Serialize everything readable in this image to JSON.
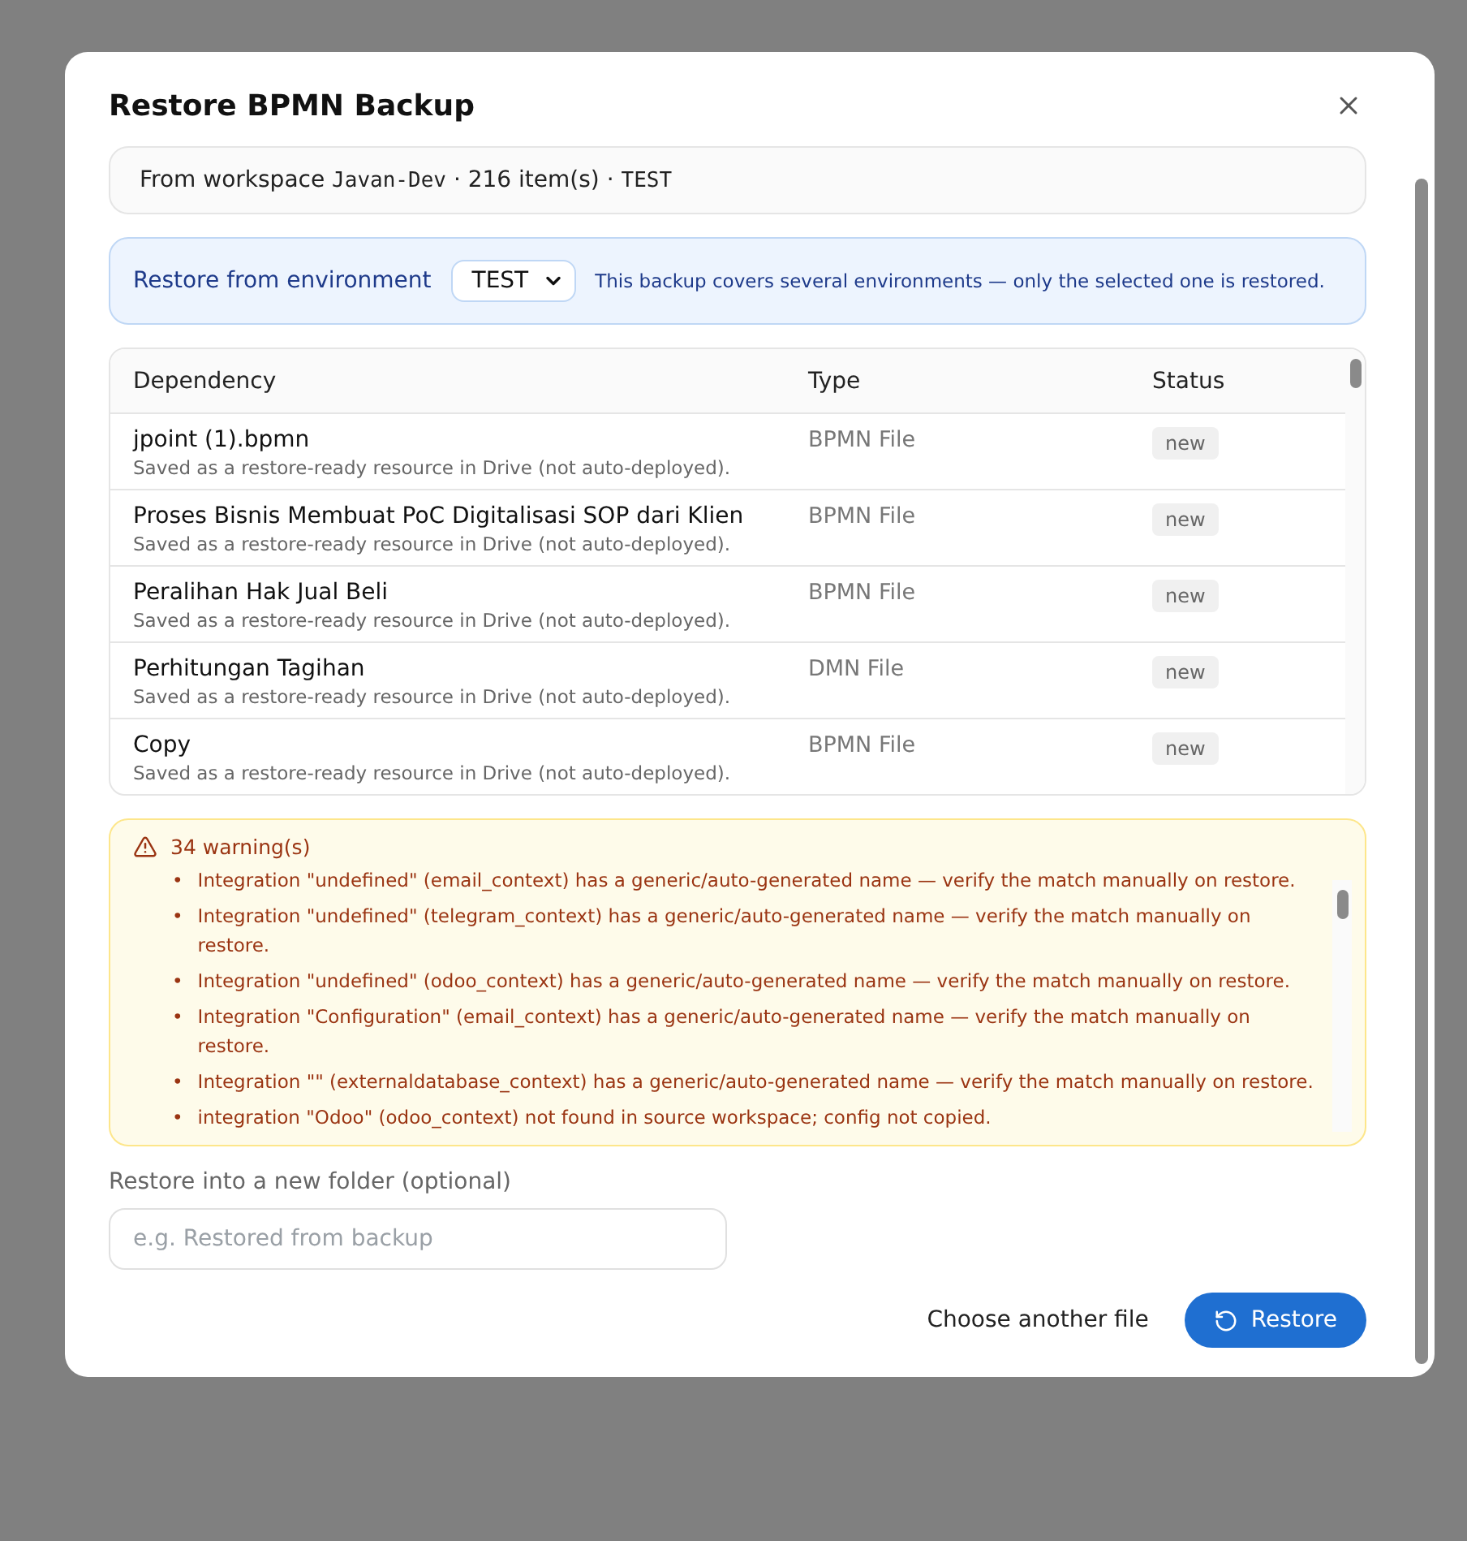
{
  "dialog": {
    "title": "Restore BPMN Backup"
  },
  "source": {
    "separator": "·",
    "prefix": "From workspace",
    "workspace": "Javan-Dev",
    "count": "216 item(s)",
    "environment": "TEST"
  },
  "environment": {
    "label": "Restore from environment",
    "value": "TEST",
    "note": "This backup covers several environments — only the selected one is restored."
  },
  "table": {
    "columns": [
      "Dependency",
      "Type",
      "Status"
    ],
    "rows": [
      {
        "name": "jpoint (1).bpmn",
        "note": "Saved as a restore-ready resource in Drive (not auto-deployed).",
        "type": "BPMN File",
        "status": "new"
      },
      {
        "name": "Proses Bisnis Membuat PoC Digitalisasi SOP dari Klien",
        "note": "Saved as a restore-ready resource in Drive (not auto-deployed).",
        "type": "BPMN File",
        "status": "new"
      },
      {
        "name": "Peralihan Hak Jual Beli",
        "note": "Saved as a restore-ready resource in Drive (not auto-deployed).",
        "type": "BPMN File",
        "status": "new"
      },
      {
        "name": "Perhitungan Tagihan",
        "note": "Saved as a restore-ready resource in Drive (not auto-deployed).",
        "type": "DMN File",
        "status": "new"
      },
      {
        "name": "Copy",
        "note": "Saved as a restore-ready resource in Drive (not auto-deployed).",
        "type": "BPMN File",
        "status": "new"
      }
    ]
  },
  "warnings": {
    "title": "34 warning(s)",
    "bullet": "•",
    "items": [
      "Integration \"undefined\" (email_context) has a generic/auto-generated name — verify the match manually on restore.",
      "Integration \"undefined\" (telegram_context) has a generic/auto-generated name — verify the match manually on restore.",
      "Integration \"undefined\" (odoo_context) has a generic/auto-generated name — verify the match manually on restore.",
      "Integration \"Configuration\" (email_context) has a generic/auto-generated name — verify the match manually on restore.",
      "Integration \"\" (externaldatabase_context) has a generic/auto-generated name — verify the match manually on restore.",
      "integration \"Odoo\" (odoo_context) not found in source workspace; config not copied."
    ]
  },
  "folder": {
    "label": "Restore into a new folder (optional)",
    "placeholder": "e.g. Restored from backup"
  },
  "footer": {
    "secondary": "Choose another file",
    "primary": "Restore"
  }
}
